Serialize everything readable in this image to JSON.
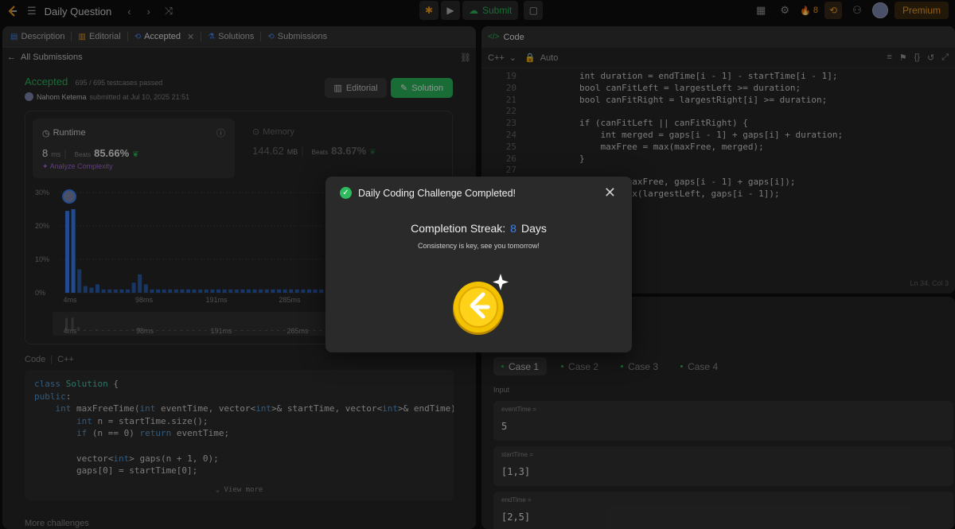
{
  "topbar": {
    "title": "Daily Question",
    "submit_label": "Submit",
    "streak_count": "8",
    "premium_label": "Premium"
  },
  "left": {
    "tabs": [
      {
        "label": "Description",
        "icon": "description-icon"
      },
      {
        "label": "Editorial",
        "icon": "book-icon"
      },
      {
        "label": "Accepted",
        "icon": "history-icon"
      },
      {
        "label": "Solutions",
        "icon": "flask-icon"
      },
      {
        "label": "Submissions",
        "icon": "history-icon"
      }
    ],
    "back_label": "All Submissions",
    "status": "Accepted",
    "testcases": "695 / 695 testcases passed",
    "user": "Nahom Ketema",
    "submitted_text": "submitted at Jul 10, 2025 21:51",
    "editorial_btn": "Editorial",
    "solution_btn": "Solution",
    "runtime": {
      "label": "Runtime",
      "value": "8",
      "unit": "ms",
      "beats_label": "Beats",
      "beats": "85.66%"
    },
    "analyze": "Analyze Complexity",
    "memory": {
      "label": "Memory",
      "value": "144.62",
      "unit": "MB",
      "beats_label": "Beats",
      "beats": "83.67%"
    },
    "code_label": "Code",
    "code_lang": "C++",
    "code_lines": [
      "class Solution {",
      "public:",
      "    int maxFreeTime(int eventTime, vector<int>& startTime, vector<int>& endTime) {",
      "        int n = startTime.size();",
      "        if (n == 0) return eventTime;",
      "",
      "        vector<int> gaps(n + 1, 0);",
      "        gaps[0] = startTime[0];"
    ],
    "view_more": "View more",
    "more_challenges": "More challenges"
  },
  "chart_data": {
    "type": "bar",
    "ylabels": [
      "30%",
      "20%",
      "10%",
      "0%"
    ],
    "ylim": [
      0,
      30
    ],
    "xticks": [
      "4ms",
      "98ms",
      "191ms",
      "285ms"
    ],
    "values": [
      24.5,
      25,
      7,
      2,
      1.5,
      2.5,
      1,
      1,
      1,
      1,
      1,
      3,
      5.5,
      2.5,
      1,
      1,
      1,
      1,
      1,
      1,
      1,
      1,
      1,
      1,
      1,
      1,
      1,
      1,
      1,
      1,
      1,
      1,
      1,
      1,
      1,
      1,
      1,
      1,
      1,
      1,
      1,
      1,
      1,
      1,
      1,
      1,
      1,
      1,
      1,
      1
    ]
  },
  "right": {
    "tab_label": "Code",
    "lang": "C++",
    "auto": "Auto",
    "editor_lines": [
      {
        "n": "19",
        "t": "        int duration = endTime[i - 1] - startTime[i - 1];"
      },
      {
        "n": "20",
        "t": "        bool canFitLeft = largestLeft >= duration;"
      },
      {
        "n": "21",
        "t": "        bool canFitRight = largestRight[i] >= duration;"
      },
      {
        "n": "22",
        "t": ""
      },
      {
        "n": "23",
        "t": "        if (canFitLeft || canFitRight) {"
      },
      {
        "n": "24",
        "t": "            int merged = gaps[i - 1] + gaps[i] + duration;"
      },
      {
        "n": "25",
        "t": "            maxFree = max(maxFree, merged);"
      },
      {
        "n": "26",
        "t": "        }"
      },
      {
        "n": "27",
        "t": ""
      },
      {
        "n": "",
        "t": "                (maxFree, gaps[i - 1] + gaps[i]);"
      },
      {
        "n": "",
        "t": "                max(largestLeft, gaps[i - 1]);"
      }
    ],
    "status": "Ln 34, Col 3"
  },
  "testcases": {
    "cases": [
      "Case 1",
      "Case 2",
      "Case 3",
      "Case 4"
    ],
    "input_label": "Input",
    "inputs": [
      {
        "key": "eventTime =",
        "value": "5"
      },
      {
        "key": "startTime =",
        "value": "[1,3]"
      },
      {
        "key": "endTime =",
        "value": "[2,5]"
      }
    ]
  },
  "modal": {
    "title": "Daily Coding Challenge Completed!",
    "streak_prefix": "Completion Streak:",
    "streak_num": "8",
    "streak_suffix": "Days",
    "subtitle": "Consistency is key, see you tomorrow!"
  }
}
